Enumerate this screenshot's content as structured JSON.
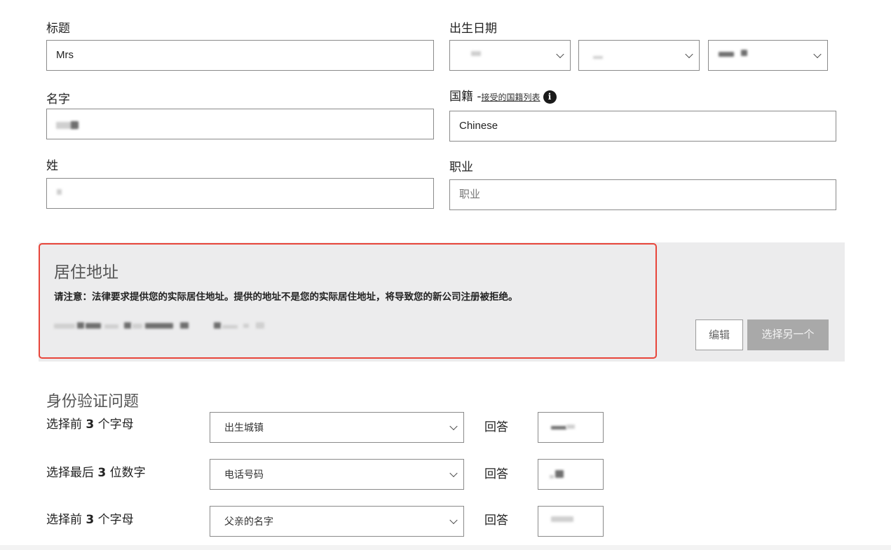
{
  "personal": {
    "title_label": "标题",
    "title_value": "Mrs",
    "first_name_label": "名字",
    "last_name_label": "姓",
    "dob_label": "出生日期",
    "nationality_label": "国籍 -",
    "nationality_link": "接受的国籍列表",
    "nationality_value": "Chinese",
    "occupation_label": "职业",
    "occupation_placeholder": "职业"
  },
  "address": {
    "heading": "居住地址",
    "notice": "请注意：法律要求提供您的实际居住地址。提供的地址不是您的实际居住地址，将导致您的新公司注册被拒绝。",
    "edit_button": "编辑",
    "choose_other_button": "选择另一个"
  },
  "security": {
    "heading": "身份验证问题",
    "answer_label": "回答",
    "questions": [
      {
        "prefix": "选择前 ",
        "num": "3",
        "suffix": " 个字母",
        "selected": "出生城镇"
      },
      {
        "prefix": "选择最后 ",
        "num": "3",
        "suffix": " 位数字",
        "selected": "电话号码"
      },
      {
        "prefix": "选择前 ",
        "num": "3",
        "suffix": " 个字母",
        "selected": "父亲的名字"
      }
    ]
  },
  "icons": {
    "info": "info-icon",
    "dropdown": "chevron-down-icon"
  },
  "colors": {
    "highlight_border": "#e8453a",
    "panel_bg": "#ececed",
    "disabled_button": "#a9a9a9"
  }
}
